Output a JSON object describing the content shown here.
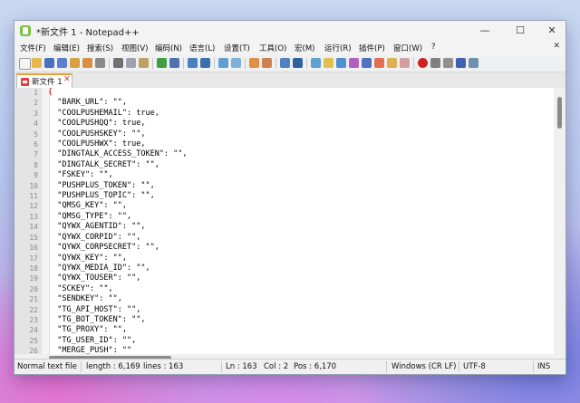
{
  "window": {
    "title": "*新文件 1 - Notepad++",
    "controls": {
      "minimize": "—",
      "maximize": "☐",
      "close": "✕"
    }
  },
  "menu": {
    "items": [
      "文件(F)",
      "编辑(E)",
      "搜索(S)",
      "视图(V)",
      "编码(N)",
      "语言(L)",
      "设置(T)",
      "工具(O)",
      "宏(M)",
      "运行(R)",
      "插件(P)",
      "窗口(W)",
      "?"
    ],
    "close": "✕"
  },
  "tab": {
    "label": "新文件 1",
    "close": "✕"
  },
  "editor": {
    "line_numbers": [
      "1",
      "2",
      "3",
      "4",
      "5",
      "6",
      "7",
      "8",
      "9",
      "10",
      "11",
      "12",
      "13",
      "14",
      "15",
      "16",
      "17",
      "18",
      "19",
      "20",
      "21",
      "22",
      "23",
      "24",
      "25",
      "26"
    ],
    "lines": [
      "{",
      "  \"BARK_URL\": \"\",",
      "  \"COOLPUSHEMAIL\": true,",
      "  \"COOLPUSHQQ\": true,",
      "  \"COOLPUSHSKEY\": \"\",",
      "  \"COOLPUSHWX\": true,",
      "  \"DINGTALK_ACCESS_TOKEN\": \"\",",
      "  \"DINGTALK_SECRET\": \"\",",
      "  \"FSKEY\": \"\",",
      "  \"PUSHPLUS_TOKEN\": \"\",",
      "  \"PUSHPLUS_TOPIC\": \"\",",
      "  \"QMSG_KEY\": \"\",",
      "  \"QMSG_TYPE\": \"\",",
      "  \"QYWX_AGENTID\": \"\",",
      "  \"QYWX_CORPID\": \"\",",
      "  \"QYWX_CORPSECRET\": \"\",",
      "  \"QYWX_KEY\": \"\",",
      "  \"QYWX_MEDIA_ID\": \"\",",
      "  \"QYWX_TOUSER\": \"\",",
      "  \"SCKEY\": \"\",",
      "  \"SENDKEY\": \"\",",
      "  \"TG_API_HOST\": \"\",",
      "  \"TG_BOT_TOKEN\": \"\",",
      "  \"TG_PROXY\": \"\",",
      "  \"TG_USER_ID\": \"\",",
      "  \"MERGE_PUSH\": \"\""
    ]
  },
  "status": {
    "filetype": "Normal text file",
    "length": "length : 6,169",
    "lines": "lines : 163",
    "ln": "Ln : 163",
    "col": "Col : 2",
    "pos": "Pos : 6,170",
    "eol": "Windows (CR LF)",
    "encoding": "UTF-8",
    "mode": "INS"
  },
  "colors": {
    "tab_accent": "#f0a030",
    "brace": "#d00000",
    "app_icon": "#7ac142"
  }
}
